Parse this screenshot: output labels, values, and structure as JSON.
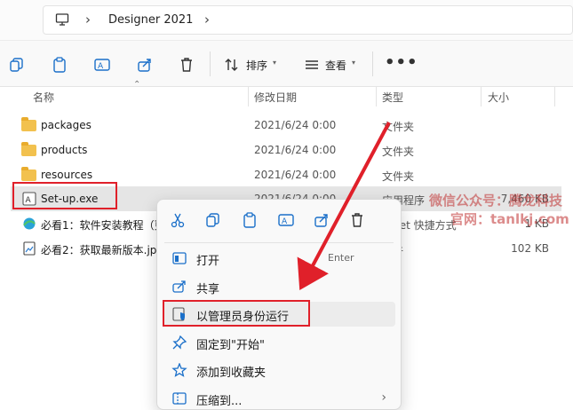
{
  "address": {
    "segment": "Designer 2021"
  },
  "toolbar": {
    "sort_label": "排序",
    "view_label": "查看"
  },
  "columns": {
    "name": "名称",
    "date": "修改日期",
    "type": "类型",
    "size": "大小"
  },
  "files": [
    {
      "name": "packages",
      "date": "2021/6/24 0:00",
      "type": "文件夹",
      "size": ""
    },
    {
      "name": "products",
      "date": "2021/6/24 0:00",
      "type": "文件夹",
      "size": ""
    },
    {
      "name": "resources",
      "date": "2021/6/24 0:00",
      "type": "文件夹",
      "size": ""
    },
    {
      "name": "Set-up.exe",
      "date": "2021/6/24 0:00",
      "type": "应用程序",
      "size": "7,460 KB"
    },
    {
      "name": "必看1：软件安装教程（更",
      "date": "",
      "type": "ernet 快捷方式",
      "size": "1 KB"
    },
    {
      "name": "必看2：获取最新版本.jpg",
      "date": "",
      "type": "文件",
      "size": "102 KB"
    }
  ],
  "context_menu": {
    "items": [
      {
        "label": "打开",
        "shortcut": "Enter"
      },
      {
        "label": "共享"
      },
      {
        "label": "以管理员身份运行"
      },
      {
        "label": "固定到\"开始\""
      },
      {
        "label": "添加到收藏夹"
      },
      {
        "label": "压缩到..."
      }
    ]
  },
  "watermark": {
    "line1": "微信公众号：腾龙科技",
    "line2": "官网：tanlkj.com"
  },
  "colors": {
    "highlight_red": "#e0202a",
    "folder_yellow": "#f2c14e",
    "selection_gray": "#e5e5e5"
  }
}
